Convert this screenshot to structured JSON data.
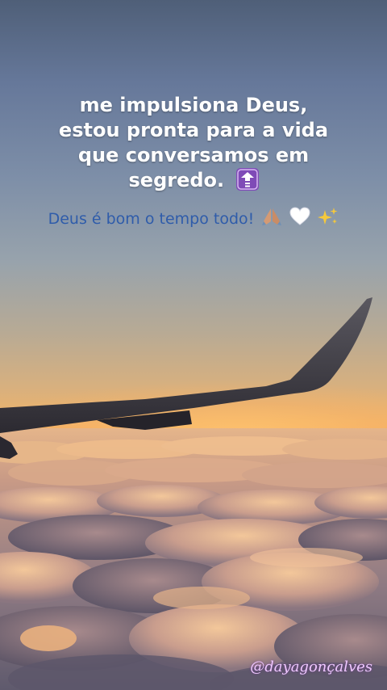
{
  "quote": {
    "lines": [
      "me impulsiona Deus,",
      "estou pronta para a vida",
      "que conversamos em",
      "segredo."
    ],
    "emoji_icon": "upward-arrow-icon"
  },
  "caption": {
    "text": "Deus é bom o tempo todo!",
    "emojis": [
      "praying-hands-icon",
      "white-heart-icon",
      "sparkles-icon"
    ]
  },
  "watermark": {
    "text": "@dayagonçalves"
  },
  "colors": {
    "quote_text": "#ffffff",
    "caption_text": "#2f5caa",
    "watermark_text": "#efc8ff",
    "arrow_badge": "#7f4bb7"
  }
}
